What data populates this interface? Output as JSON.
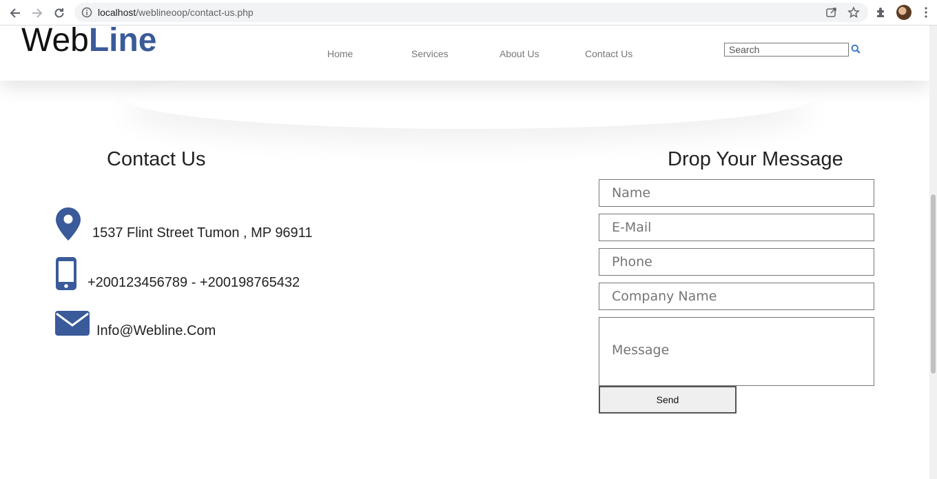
{
  "browser": {
    "url_host": "localhost",
    "url_path": "/weblineoop/contact-us.php"
  },
  "site": {
    "logo_part1": "Web",
    "logo_part2": "Line",
    "nav": [
      {
        "label": "Home"
      },
      {
        "label": "Services"
      },
      {
        "label": "About Us"
      },
      {
        "label": "Contact Us"
      }
    ],
    "search": {
      "placeholder": "Search"
    }
  },
  "contact": {
    "title": "Contact Us",
    "address": "1537 Flint Street Tumon , MP 96911",
    "phone": "+200123456789 - +200198765432",
    "email": "Info@Webline.Com"
  },
  "form": {
    "title": "Drop Your Message",
    "name_placeholder": "Name",
    "email_placeholder": "E-Mail",
    "phone_placeholder": "Phone",
    "company_placeholder": "Company Name",
    "message_placeholder": "Message",
    "send_label": "Send"
  },
  "colors": {
    "brand": "#3a5a99",
    "icon": "#3a5a99"
  },
  "icons": [
    "back-icon",
    "forward-icon",
    "reload-icon",
    "info-icon",
    "share-icon",
    "star-icon",
    "extensions-icon",
    "menu-icon",
    "search-icon",
    "map-marker-icon",
    "mobile-phone-icon",
    "envelope-icon"
  ]
}
